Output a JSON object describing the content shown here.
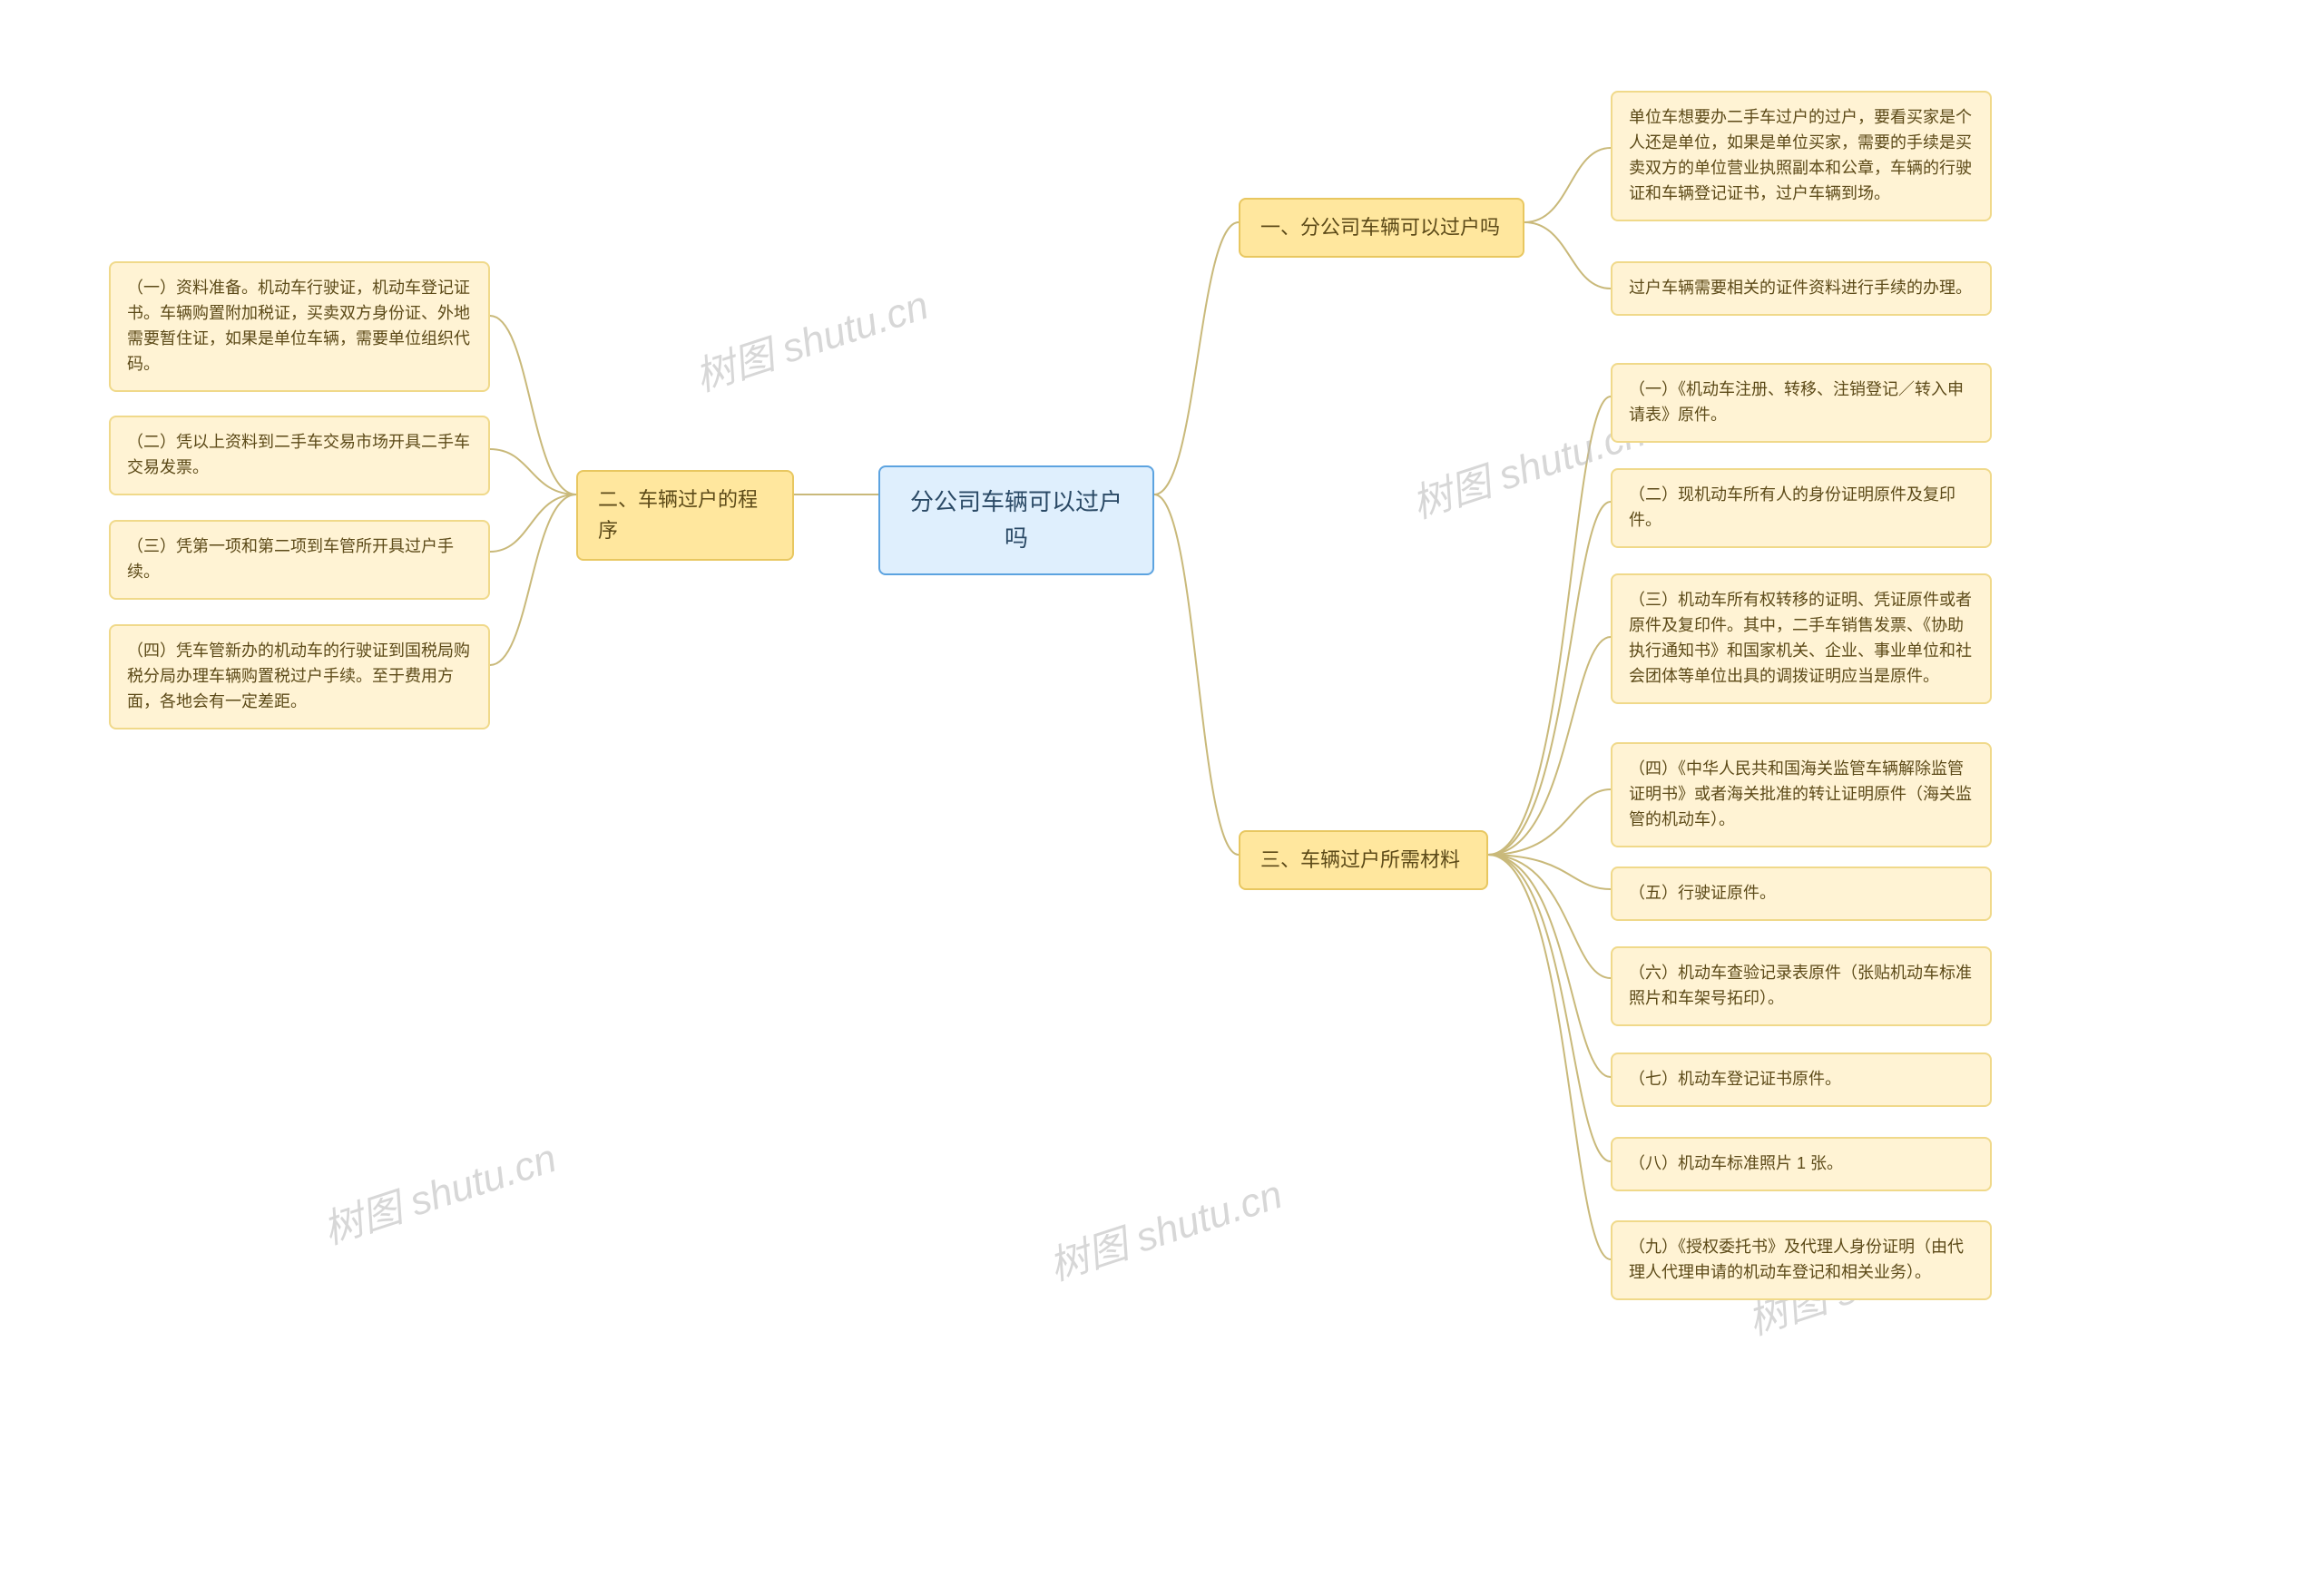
{
  "center": {
    "title": "分公司车辆可以过户吗"
  },
  "branch1": {
    "label": "一、分公司车辆可以过户吗"
  },
  "branch2": {
    "label": "二、车辆过户的程序"
  },
  "branch3": {
    "label": "三、车辆过户所需材料"
  },
  "leafA1": "单位车想要办二手车过户的过户，要看买家是个人还是单位，如果是单位买家，需要的手续是买卖双方的单位营业执照副本和公章，车辆的行驶证和车辆登记证书，过户车辆到场。",
  "leafA2": "过户车辆需要相关的证件资料进行手续的办理。",
  "leafB1": "（一）资料准备。机动车行驶证，机动车登记证书。车辆购置附加税证，买卖双方身份证、外地需要暂住证，如果是单位车辆，需要单位组织代码。",
  "leafB2": "（二）凭以上资料到二手车交易市场开具二手车交易发票。",
  "leafB3": "（三）凭第一项和第二项到车管所开具过户手续。",
  "leafB4": "（四）凭车管新办的机动车的行驶证到国税局购税分局办理车辆购置税过户手续。至于费用方面，各地会有一定差距。",
  "leafC1": "（一）《机动车注册、转移、注销登记／转入申请表》原件。",
  "leafC2": "（二）现机动车所有人的身份证明原件及复印件。",
  "leafC3": "（三）机动车所有权转移的证明、凭证原件或者原件及复印件。其中，二手车销售发票、《协助执行通知书》和国家机关、企业、事业单位和社会团体等单位出具的调拨证明应当是原件。",
  "leafC4": "（四）《中华人民共和国海关监管车辆解除监管证明书》或者海关批准的转让证明原件（海关监管的机动车）。",
  "leafC5": "（五）行驶证原件。",
  "leafC6": "（六）机动车查验记录表原件（张贴机动车标准照片和车架号拓印）。",
  "leafC7": "（七）机动车登记证书原件。",
  "leafC8": "（八）机动车标准照片 1 张。",
  "leafC9": "（九）《授权委托书》及代理人身份证明（由代理人代理申请的机动车登记和相关业务）。",
  "watermarks": {
    "w1": "树图 shutu.cn",
    "w2": "树图 shutu.cn",
    "w3": "树图 shutu.cn",
    "w4": "树图 shutu.cn",
    "w5": "树图 shutu.cn"
  }
}
